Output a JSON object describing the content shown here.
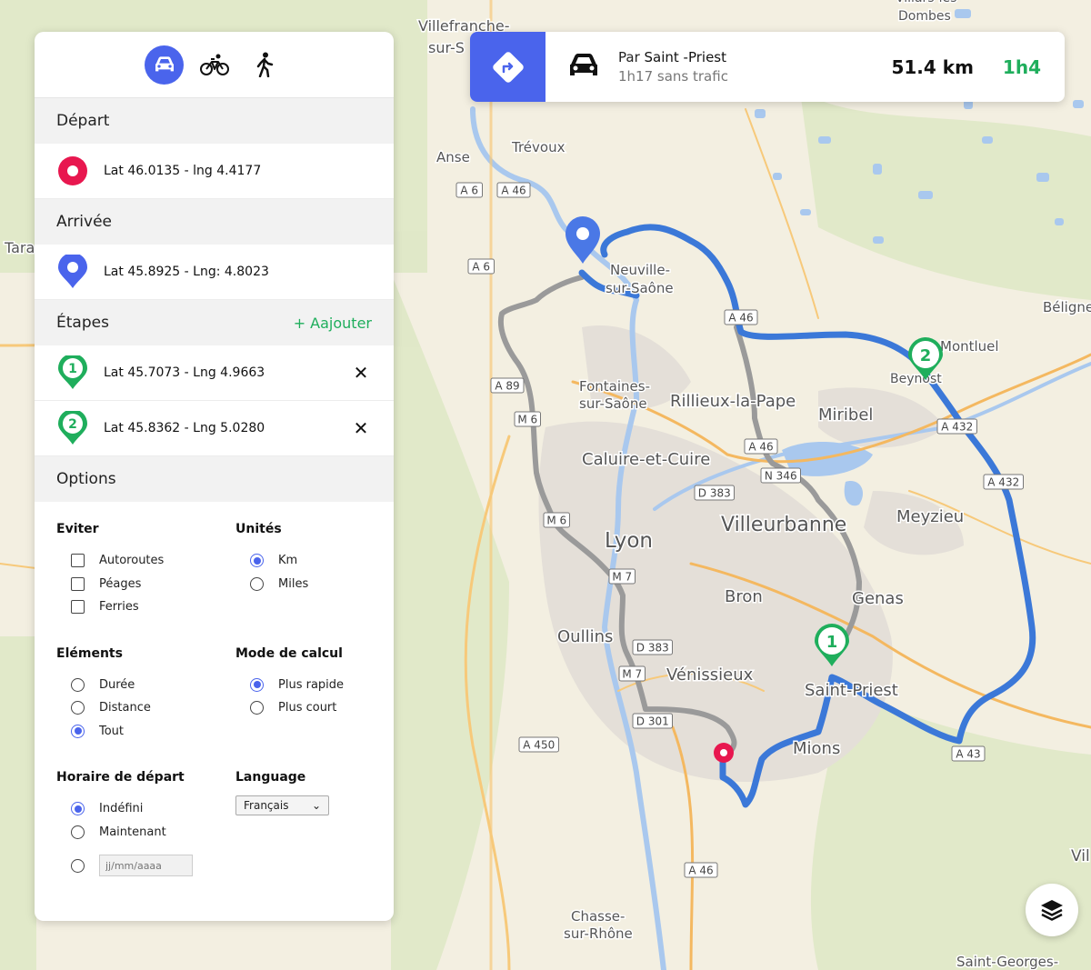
{
  "panel": {
    "modes": [
      {
        "icon": "car-icon",
        "active": true
      },
      {
        "icon": "bike-icon",
        "active": false
      },
      {
        "icon": "walk-icon",
        "active": false
      }
    ],
    "depart_title": "Départ",
    "depart_value": "Lat 46.0135 - lng 4.4177",
    "arrivee_title": "Arrivée",
    "arrivee_value": "Lat 45.8925 - Lng: 4.8023",
    "etapes_title": "Étapes",
    "add_label": "+  Aajouter",
    "etapes": [
      {
        "num": "1",
        "value": "Lat 45.7073 - Lng 4.9663"
      },
      {
        "num": "2",
        "value": "Lat 45.8362 - Lng 5.0280"
      }
    ],
    "options_title": "Options",
    "eviter": {
      "title": "Eviter",
      "items": [
        "Autoroutes",
        "Péages",
        "Ferries"
      ]
    },
    "unites": {
      "title": "Unités",
      "items": [
        "Km",
        "Miles"
      ],
      "selected": 0
    },
    "elements": {
      "title": "Eléments",
      "items": [
        "Durée",
        "Distance",
        "Tout"
      ],
      "selected": 2
    },
    "mode_calcul": {
      "title": "Mode de calcul",
      "items": [
        "Plus rapide",
        "Plus court"
      ],
      "selected": 0
    },
    "horaire": {
      "title": "Horaire de départ",
      "items": [
        "Indéfini",
        "Maintenant"
      ],
      "selected": 0,
      "date_placeholder": "jj/mm/aaaa"
    },
    "language": {
      "title": "Language",
      "value": "Français"
    }
  },
  "route": {
    "via_prefix": "Par",
    "via_name": "Saint -Priest",
    "no_traffic": "1h17 sans trafic",
    "distance": "51.4 km",
    "duration": "1h4"
  },
  "colors": {
    "accent": "#4a64ec",
    "green": "#1fae5c",
    "origin": "#e8174f",
    "route": "#3b78d8",
    "alt_route": "#9a9a9a"
  },
  "map": {
    "places": [
      {
        "name": "Villefranche-",
        "size": 16
      },
      {
        "name": "sur-S",
        "size": 16
      },
      {
        "name": "Dombes",
        "size": 14
      },
      {
        "name": "Villars-les-",
        "size": 14
      },
      {
        "name": "Trévoux",
        "size": 15
      },
      {
        "name": "Anse",
        "size": 15
      },
      {
        "name": "Tara",
        "size": 16
      },
      {
        "name": "Neuville-",
        "size": 15
      },
      {
        "name": "sur-Saône",
        "size": 15
      },
      {
        "name": "Béligne",
        "size": 15
      },
      {
        "name": "Montluel",
        "size": 15
      },
      {
        "name": "Beynost",
        "size": 14
      },
      {
        "name": "Fontaines-",
        "size": 15
      },
      {
        "name": "sur-Saône",
        "size": 15
      },
      {
        "name": "Rillieux-la-Pape",
        "size": 18
      },
      {
        "name": "Miribel",
        "size": 18
      },
      {
        "name": "Caluire-et-Cuire",
        "size": 18
      },
      {
        "name": "Villeurbanne",
        "size": 22
      },
      {
        "name": "Meyzieu",
        "size": 18
      },
      {
        "name": "Lyon",
        "size": 23
      },
      {
        "name": "Bron",
        "size": 18
      },
      {
        "name": "Genas",
        "size": 18
      },
      {
        "name": "Oullins",
        "size": 18
      },
      {
        "name": "Vénissieux",
        "size": 18
      },
      {
        "name": "Saint-Priest",
        "size": 18
      },
      {
        "name": "Mions",
        "size": 18
      },
      {
        "name": "Vil",
        "size": 17
      },
      {
        "name": "Chasse-",
        "size": 15
      },
      {
        "name": "sur-Rhône",
        "size": 15
      },
      {
        "name": "Saint-Georges-",
        "size": 15
      }
    ],
    "shields": [
      "A 6",
      "A 46",
      "A 6",
      "A 46",
      "A 89",
      "M 6",
      "A 46",
      "N 346",
      "D 383",
      "A 432",
      "A 432",
      "M 6",
      "M 7",
      "D 383",
      "M 7",
      "D 301",
      "A 450",
      "A 43",
      "A 46"
    ]
  }
}
